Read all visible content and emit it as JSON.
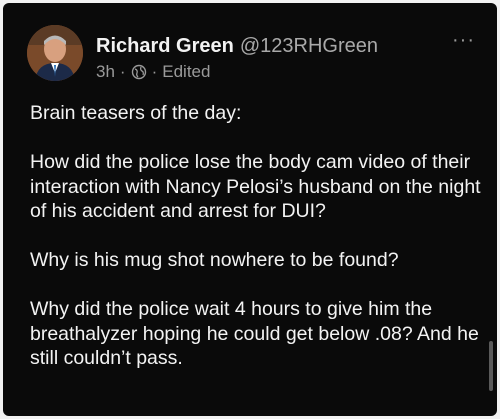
{
  "post": {
    "author_name": "Richard Green",
    "author_handle": "@123RHGreen",
    "time": "3h",
    "separator": "·",
    "edited": "Edited",
    "more_icon": "···",
    "icons": {
      "visibility": "globe-icon",
      "more": "more-options-icon"
    },
    "colors": {
      "background": "#0a0a0a",
      "text": "#f3f3f3",
      "muted": "#9a9a9a"
    },
    "paragraphs": [
      "Brain teasers of the day:",
      "How did the police lose the body cam video of their interaction with Nancy Pelosi’s husband on the night of his accident and arrest for DUI?",
      "Why is his mug shot nowhere to be found?",
      "Why did the police wait 4 hours to give him the breathalyzer hoping he could get below .08? And he still couldn’t pass."
    ]
  }
}
